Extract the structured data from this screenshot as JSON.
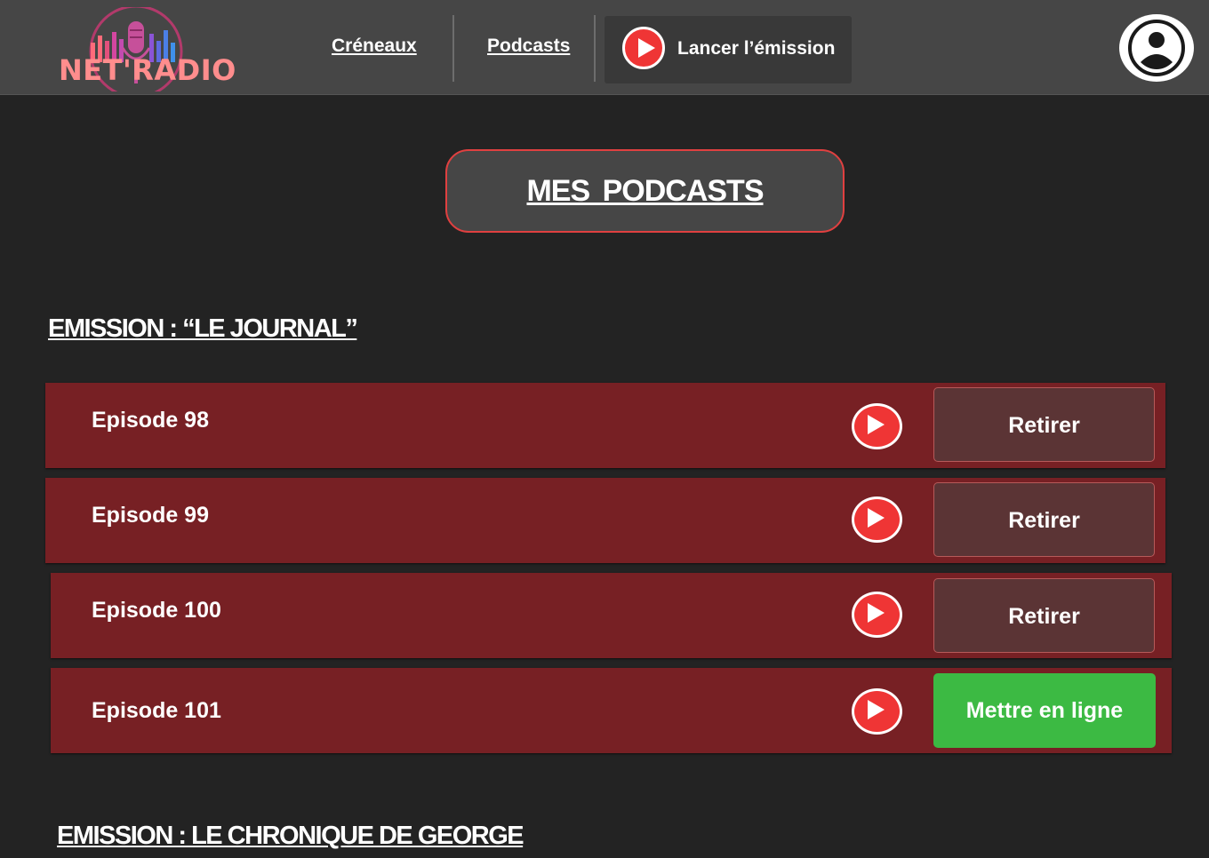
{
  "brand": {
    "logo_text": "NET'RADIO"
  },
  "nav": {
    "creneaux": "Créneaux",
    "podcasts": "Podcasts",
    "launch": "Lancer l’émission"
  },
  "page_title": "MES PODCASTS",
  "sections": [
    {
      "title": "EMISSION : “LE JOURNAL”",
      "episodes": [
        {
          "label": "Episode 98",
          "action": "Retirer"
        },
        {
          "label": "Episode 99",
          "action": "Retirer"
        },
        {
          "label": "Episode 100",
          "action": "Retirer"
        },
        {
          "label": "Episode 101",
          "action": "Mettre en ligne"
        }
      ]
    },
    {
      "title": "EMISSION : LE CHRONIQUE DE GEORGE"
    }
  ],
  "icons": {
    "play": "play-icon",
    "profile": "user-profile-icon",
    "logo": "microphone-equalizer-logo"
  },
  "colors": {
    "navbar": "#464646",
    "background": "#232323",
    "episode_row": "#772024",
    "play": "#ef3535",
    "remove_button": "#5b3435",
    "publish_button": "#3cba43",
    "accent_border": "#e04040"
  }
}
